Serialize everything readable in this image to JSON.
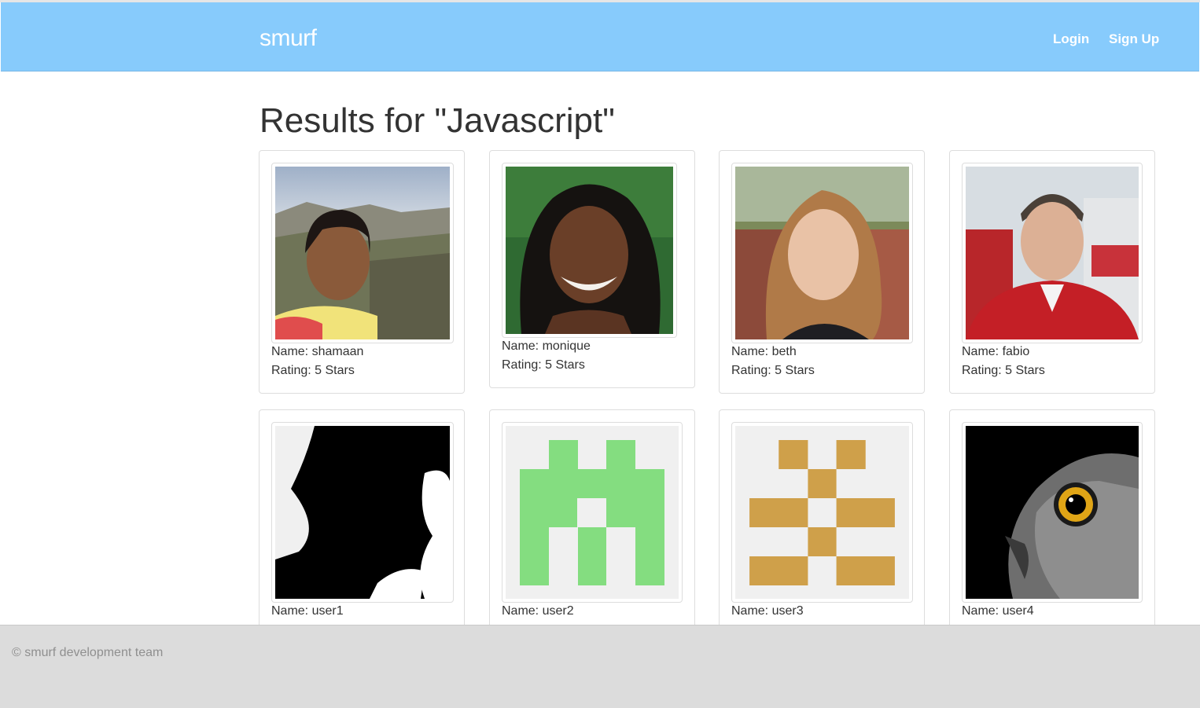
{
  "nav": {
    "brand": "smurf",
    "login_label": "Login",
    "signup_label": "Sign Up",
    "background_color": "#87cbfc"
  },
  "page": {
    "title": "Results for \"Javascript\""
  },
  "results": [
    {
      "name_text": "Name: shamaan",
      "rating_text": "Rating: 5 Stars",
      "avatar": "photo-woman-mountain-selfie"
    },
    {
      "name_text": "Name: monique",
      "rating_text": "Rating: 5 Stars",
      "avatar": "photo-woman-curly-hair"
    },
    {
      "name_text": "Name: beth",
      "rating_text": "Rating: 5 Stars",
      "avatar": "photo-woman-wavy-hair"
    },
    {
      "name_text": "Name: fabio",
      "rating_text": "Rating: 5 Stars",
      "avatar": "photo-man-red-jacket"
    },
    {
      "name_text": "Name: user1",
      "avatar": "silhouette-black-white"
    },
    {
      "name_text": "Name: user2",
      "avatar": "identicon-green",
      "color": "#84dd80"
    },
    {
      "name_text": "Name: user3",
      "avatar": "identicon-gold",
      "color": "#cfa04a"
    },
    {
      "name_text": "Name: user4",
      "avatar": "photo-owl"
    }
  ],
  "footer": {
    "text": "© smurf development team"
  }
}
